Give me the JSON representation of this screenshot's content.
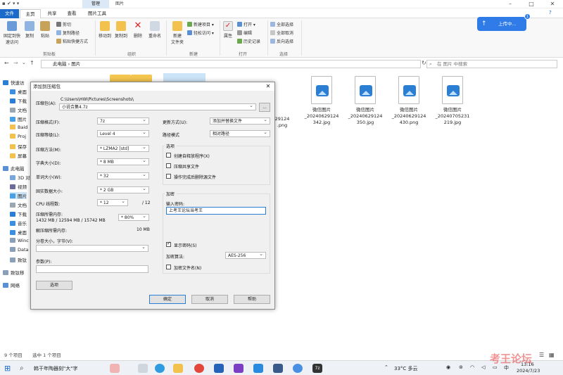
{
  "window": {
    "context_tab": "管理",
    "title": "图片",
    "quick_access": "▪ ✔ ▾ ▾"
  },
  "ribbon": {
    "tabs": [
      "文件",
      "主页",
      "共享",
      "查看",
      "图片工具"
    ],
    "pin_label": "固定到快\n速访问",
    "copy_label": "复制",
    "paste_label": "粘贴",
    "cut_label": "剪切",
    "copy_path_label": "复制路径",
    "paste_shortcut_label": "粘贴快捷方式",
    "move_to_label": "移动到",
    "copy_to_label": "复制到",
    "delete_label": "删除",
    "rename_label": "重命名",
    "new_folder_label": "新建\n文件夹",
    "new_item_label": "新建项目",
    "easy_access_label": "轻松访问",
    "properties_label": "属性",
    "open_label": "打开",
    "edit_label": "编辑",
    "history_label": "历史记录",
    "select_all_label": "全部选择",
    "select_none_label": "全部取消",
    "invert_label": "反向选择",
    "groups": [
      "剪贴板",
      "组织",
      "新建",
      "打开",
      "选择"
    ]
  },
  "address": {
    "path_root": "此电脑",
    "path_folder": "图片",
    "search_placeholder": "在 图片 中搜索"
  },
  "upload": {
    "label": "上传中...",
    "badge": "1"
  },
  "nav": [
    "快速访",
    "桌面",
    "下载",
    "文档",
    "图片",
    "Baid",
    "Proj",
    "保存",
    "屏幕",
    "此电脑",
    "3D 对",
    "视频",
    "图片",
    "文档",
    "下载",
    "音乐",
    "桌面",
    "Winc",
    "Data",
    "致钛",
    "致钛移",
    "网络"
  ],
  "files": [
    {
      "name": "微信图片\n_20240629124\n342.jpg"
    },
    {
      "name": "微信图片\n_20240629124\n350.jpg"
    },
    {
      "name": "微信图片\n_20240629124\n430.png"
    },
    {
      "name": "微信图片\n_20240705231\n219.jpg"
    }
  ],
  "partial_file": {
    "name": "29124\n.png"
  },
  "dialog": {
    "title": "添加到压缩包",
    "archive_label": "压缩包(A):",
    "archive_path": "C:\\Users\\HW\\Pictures\\Screenshots\\",
    "archive_name": "小说合集4.7z",
    "browse": "...",
    "format_label": "压缩格式(F):",
    "format_value": "7z",
    "level_label": "压缩等级(L):",
    "level_value": "Level 4",
    "method_label": "压缩方法(M):",
    "method_value": "* LZMA2 [std]",
    "dict_label": "字典大小(D):",
    "dict_value": "* 8 MB",
    "word_label": "单词大小(W):",
    "word_value": "* 32",
    "solid_label": "固实数据大小:",
    "solid_value": "* 2 GB",
    "cpu_label": "CPU 线程数:",
    "cpu_value": "* 12",
    "cpu_total": "/ 12",
    "mem_label": "压缩所需内存:",
    "mem_value": "1432 MB / 12594 MB / 15742 MB",
    "mem_percent": "* 80%",
    "decomp_label": "解压缩所需内存:",
    "decomp_value": "10 MB",
    "split_label": "分卷大小，字节(V):",
    "params_label": "参数(P):",
    "options_button": "选项",
    "update_label": "更新方式(U):",
    "update_value": "添加并替换文件",
    "path_label": "路径模式",
    "path_value": "相对路径",
    "options_group": "选项",
    "opt_sfx": "创建自释放程序(X)",
    "opt_shared": "压缩共享文件",
    "opt_delete": "操作完成后删除源文件",
    "encrypt_group": "加密",
    "password_label": "输入密码:",
    "password_value": "上考王论坛当考王",
    "show_password": "显示密码(S)",
    "enc_method_label": "加密算法:",
    "enc_method_value": "AES-256",
    "encrypt_names": "加密文件名(N)",
    "ok": "确定",
    "cancel": "取消",
    "help": "帮助"
  },
  "status": {
    "items": "9 个项目",
    "selected": "选中 1 个项目"
  },
  "taskbar": {
    "news": "韩干年陶器刻\"大\"字",
    "weather": "33°C 多云",
    "ime": "中",
    "time": "13:16",
    "date": "2024/7/23",
    "watermark": "考王论坛"
  },
  "colors": {
    "accent": "#1b6ac9",
    "upload": "#2f7ce8",
    "folder": "#f4c64f"
  }
}
